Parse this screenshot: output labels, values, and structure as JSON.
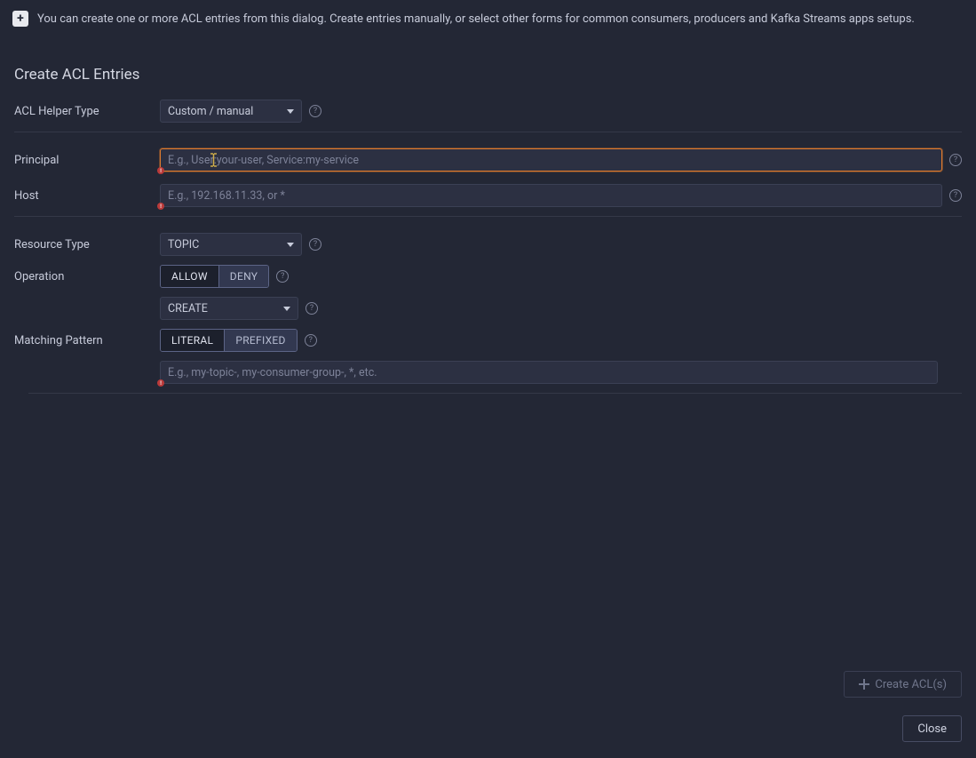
{
  "info_bar": {
    "text": "You can create one or more ACL entries from this dialog. Create entries manually, or select other forms for common consumers, producers and Kafka Streams apps setups."
  },
  "title": "Create ACL Entries",
  "fields": {
    "helper_type": {
      "label": "ACL Helper Type",
      "value": "Custom / manual"
    },
    "principal": {
      "label": "Principal",
      "placeholder": "E.g., User:your-user, Service:my-service"
    },
    "host": {
      "label": "Host",
      "placeholder": "E.g., 192.168.11.33, or *"
    },
    "resource_type": {
      "label": "Resource Type",
      "value": "TOPIC"
    },
    "operation": {
      "label": "Operation",
      "allow": "ALLOW",
      "deny": "DENY",
      "value": "CREATE"
    },
    "matching": {
      "label": "Matching Pattern",
      "literal": "LITERAL",
      "prefixed": "PREFIXED",
      "placeholder": "E.g., my-topic-, my-consumer-group-, *, etc."
    }
  },
  "footer": {
    "create": "Create ACL(s)",
    "close": "Close"
  }
}
